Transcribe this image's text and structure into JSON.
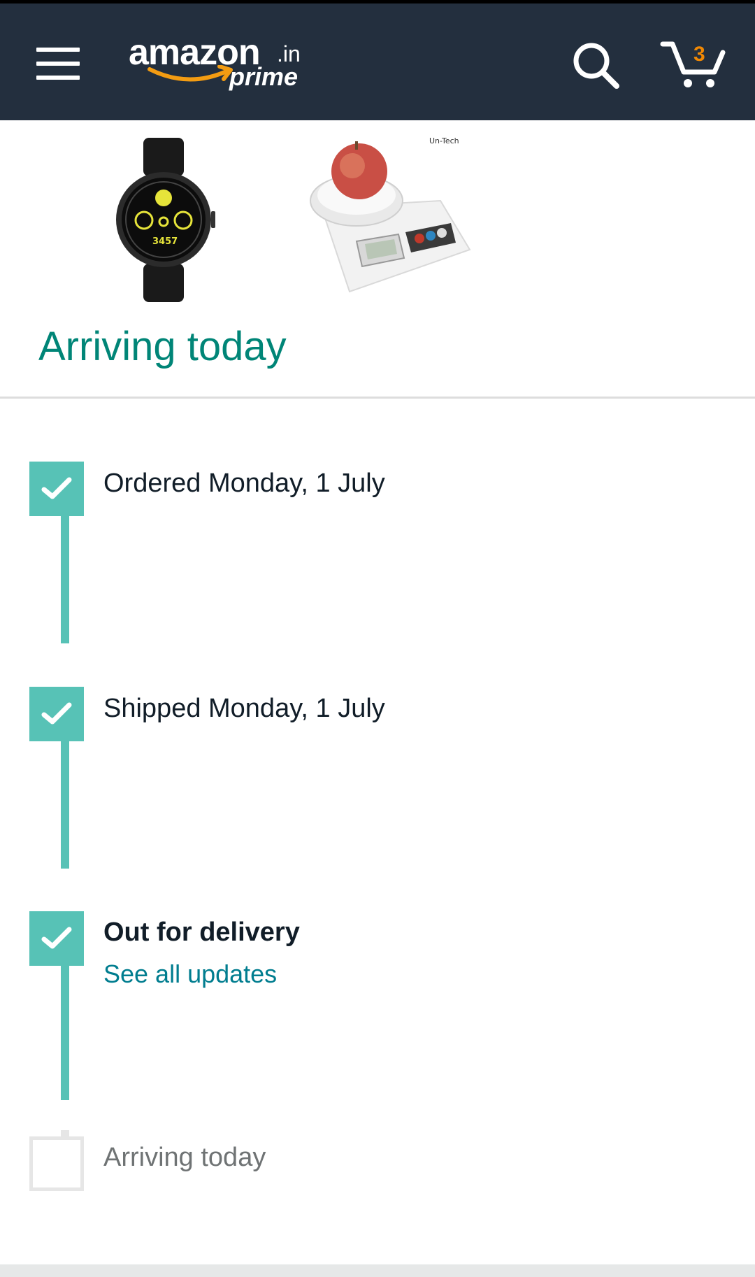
{
  "header": {
    "logo_word": "amazon",
    "logo_tld": ".in",
    "logo_sub": "prime",
    "cart_count": "3",
    "icons": [
      "menu-icon",
      "search-icon",
      "cart-icon"
    ]
  },
  "products": [
    {
      "name": "smart watch",
      "icon": "watch-image"
    },
    {
      "name": "kitchen weighing scale",
      "icon": "scale-image",
      "brand_text": "Un-Tech"
    }
  ],
  "shipment": {
    "title": "Arriving today"
  },
  "timeline": [
    {
      "label": "Ordered Monday, 1 July",
      "done": true
    },
    {
      "label": "Shipped Monday, 1 July",
      "done": true
    },
    {
      "label": "Out for delivery",
      "done": true,
      "link": "See all updates"
    },
    {
      "label": "Arriving today",
      "done": false
    }
  ],
  "colors": {
    "header_bg": "#232f3e",
    "accent_teal": "#008577",
    "timeline": "#57c2b6",
    "link": "#007d8f",
    "cart_count": "#f08804"
  }
}
